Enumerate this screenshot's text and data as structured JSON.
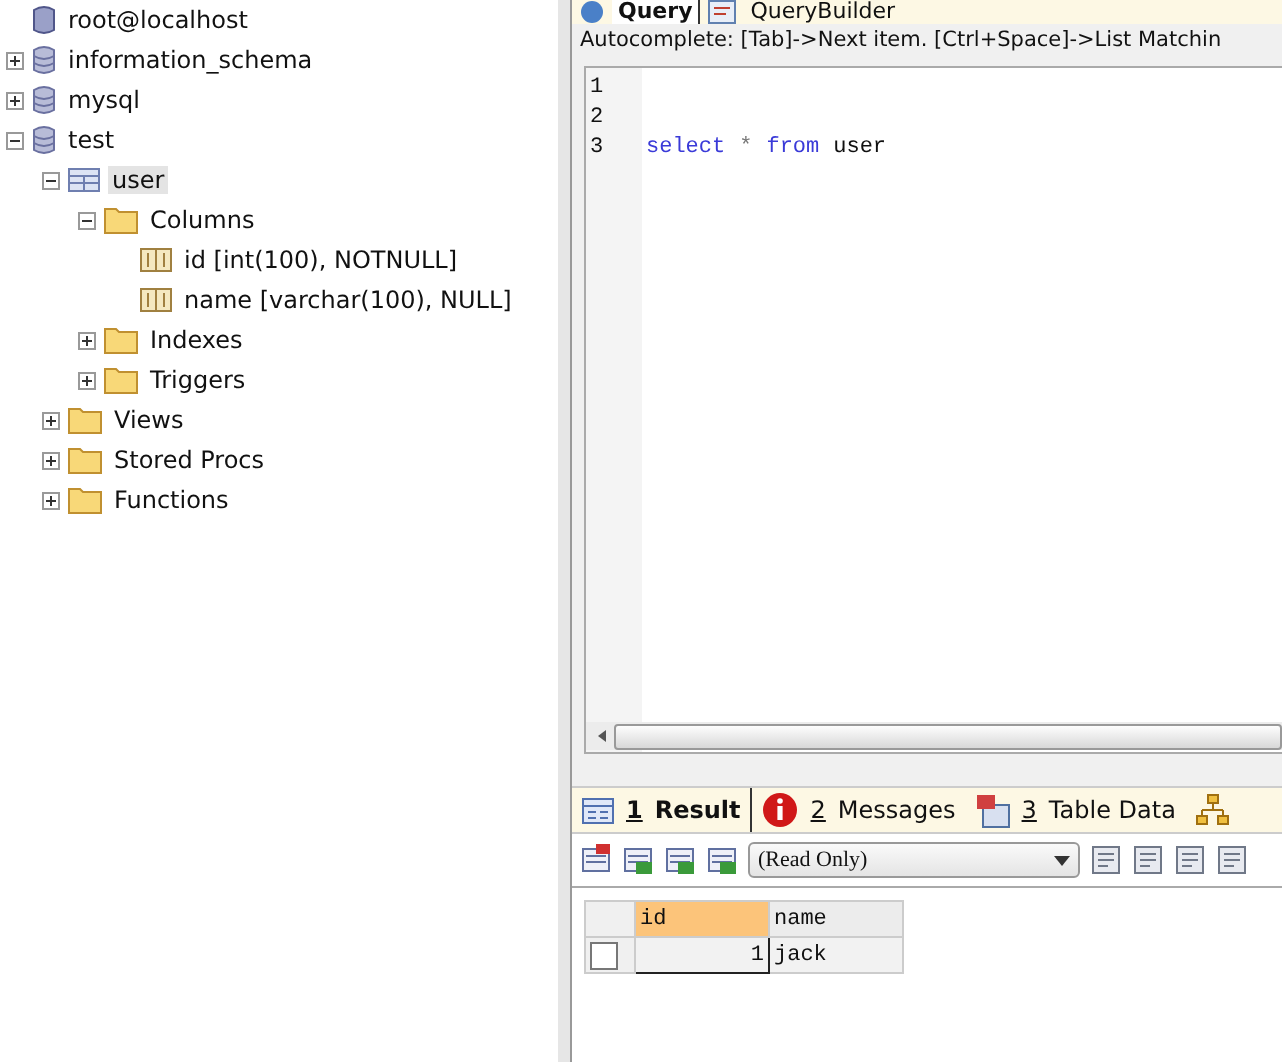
{
  "tree": [
    {
      "label": "root@localhost",
      "kind": "server",
      "selected": false
    },
    {
      "label": "information_schema",
      "kind": "database",
      "expanded": false,
      "selected": false
    },
    {
      "label": "mysql",
      "kind": "database",
      "expanded": false,
      "selected": false
    },
    {
      "label": "test",
      "kind": "database",
      "expanded": true,
      "selected": false,
      "children": [
        {
          "label": "user",
          "kind": "table",
          "expanded": true,
          "selected": true,
          "children": [
            {
              "label": "Columns",
              "kind": "folder",
              "expanded": true,
              "selected": false,
              "children": [
                {
                  "label": "id [int(100), NOTNULL]",
                  "kind": "column",
                  "selected": false
                },
                {
                  "label": "name [varchar(100), NULL]",
                  "kind": "column",
                  "selected": false
                }
              ]
            },
            {
              "label": "Indexes",
              "kind": "folder",
              "expanded": false,
              "selected": false
            },
            {
              "label": "Triggers",
              "kind": "folder",
              "expanded": false,
              "selected": false
            }
          ]
        },
        {
          "label": "Views",
          "kind": "folder",
          "expanded": false,
          "selected": false
        },
        {
          "label": "Stored Procs",
          "kind": "folder",
          "expanded": false,
          "selected": false
        },
        {
          "label": "Functions",
          "kind": "folder",
          "expanded": false,
          "selected": false
        }
      ]
    }
  ],
  "editor_tabs": [
    {
      "label": "Query",
      "selected": true
    },
    {
      "label": "QueryBuilder",
      "selected": false
    }
  ],
  "autocomplete_hint": "Autocomplete: [Tab]->Next item. [Ctrl+Space]->List Matchin",
  "code_lines": [
    {
      "number": "1"
    },
    {
      "number": "2"
    },
    {
      "number": "3",
      "tokens": [
        {
          "text": "select",
          "kind": "keyword"
        },
        {
          "text": "*",
          "kind": "operator"
        },
        {
          "text": "from",
          "kind": "keyword"
        },
        {
          "text": "user",
          "kind": "identifier"
        }
      ]
    }
  ],
  "result_tabs": [
    {
      "key": "1",
      "label": "Result",
      "selected": true,
      "kind": "result"
    },
    {
      "key": "2",
      "label": "Messages",
      "selected": false,
      "kind": "messages"
    },
    {
      "key": "3",
      "label": "Table Data",
      "selected": false,
      "kind": "table"
    },
    {
      "kind": "diagram",
      "selected": false
    }
  ],
  "result_mode": "(Read Only)",
  "grid": {
    "columns": [
      {
        "label": "id",
        "selected": true
      },
      {
        "label": "name",
        "selected": false
      }
    ],
    "rows": [
      {
        "checked": false,
        "cells": [
          "1",
          "jack"
        ]
      }
    ]
  }
}
